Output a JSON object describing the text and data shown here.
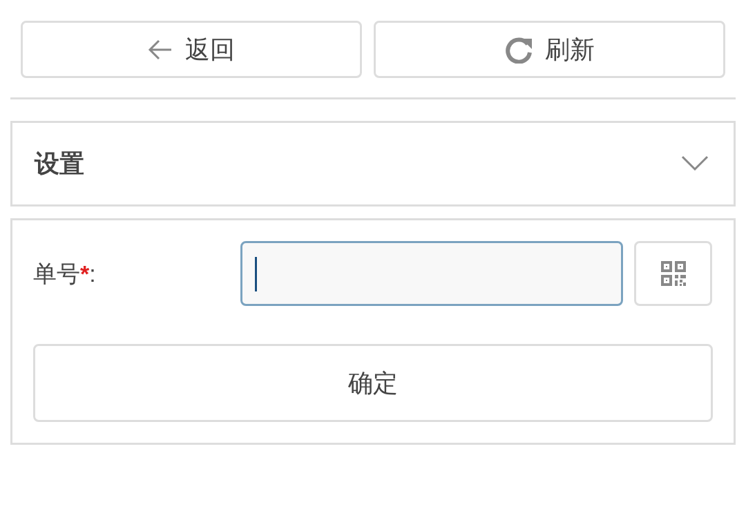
{
  "toolbar": [
    {
      "kind": "back",
      "label": "返回"
    },
    {
      "kind": "refresh",
      "label": "刷新"
    }
  ],
  "settings": {
    "title": "设置",
    "expanded": false
  },
  "form": {
    "field": {
      "label": "单号",
      "required": true,
      "required_mark": "*",
      "suffix": ":",
      "focused": true
    },
    "confirm": "确定"
  }
}
